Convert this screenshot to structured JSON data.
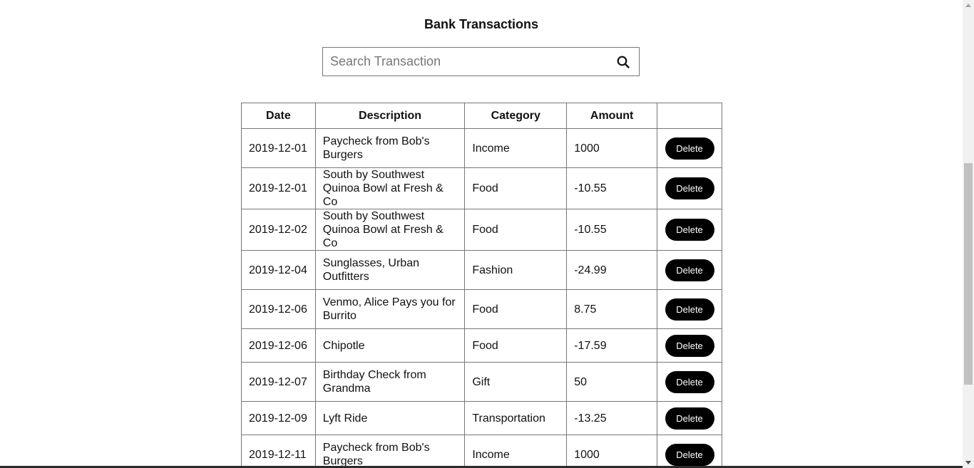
{
  "page": {
    "title": "Bank Transactions"
  },
  "search": {
    "placeholder": "Search Transaction",
    "value": "",
    "icon": "search-icon"
  },
  "table": {
    "headers": [
      "Date",
      "Description",
      "Category",
      "Amount",
      ""
    ],
    "delete_label": "Delete",
    "rows": [
      {
        "date": "2019-12-01",
        "description": "Paycheck from Bob's Burgers",
        "category": "Income",
        "amount": "1000"
      },
      {
        "date": "2019-12-01",
        "description": "South by Southwest Quinoa Bowl at Fresh & Co",
        "category": "Food",
        "amount": "-10.55"
      },
      {
        "date": "2019-12-02",
        "description": "South by Southwest Quinoa Bowl at Fresh & Co",
        "category": "Food",
        "amount": "-10.55"
      },
      {
        "date": "2019-12-04",
        "description": "Sunglasses, Urban Outfitters",
        "category": "Fashion",
        "amount": "-24.99"
      },
      {
        "date": "2019-12-06",
        "description": "Venmo, Alice Pays you for Burrito",
        "category": "Food",
        "amount": "8.75"
      },
      {
        "date": "2019-12-06",
        "description": "Chipotle",
        "category": "Food",
        "amount": "-17.59"
      },
      {
        "date": "2019-12-07",
        "description": "Birthday Check from Grandma",
        "category": "Gift",
        "amount": "50"
      },
      {
        "date": "2019-12-09",
        "description": "Lyft Ride",
        "category": "Transportation",
        "amount": "-13.25"
      },
      {
        "date": "2019-12-11",
        "description": "Paycheck from Bob's Burgers",
        "category": "Income",
        "amount": "1000"
      }
    ]
  },
  "colors": {
    "button_bg": "#000000",
    "button_text": "#ffffff",
    "border": "#777777"
  }
}
